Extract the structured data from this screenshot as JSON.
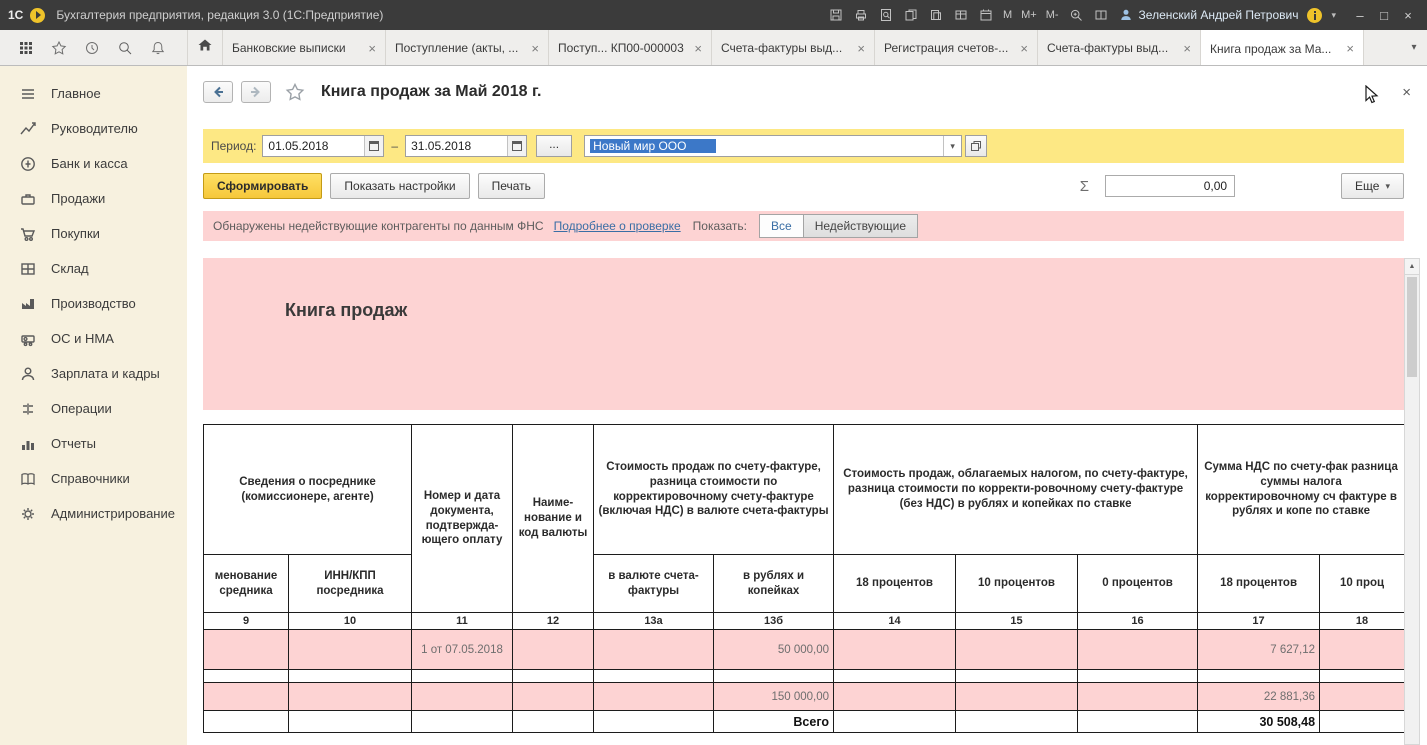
{
  "titlebar": {
    "logo": "1С",
    "title": "Бухгалтерия предприятия, редакция 3.0 (1С:Предприятие)",
    "memory_buttons": [
      "M",
      "M+",
      "M-"
    ],
    "user": "Зеленский Андрей Петрович"
  },
  "window_controls": {
    "minimize": "–",
    "maximize": "□",
    "close": "×"
  },
  "tabbar": {
    "tabs": [
      "Банковские выписки",
      "Поступление (акты, ...",
      "Поступ... КП00-000003",
      "Счета-фактуры выд...",
      "Регистрация счетов-...",
      "Счета-фактуры выд...",
      "Книга продаж за Ма..."
    ]
  },
  "sidebar": {
    "items": [
      "Главное",
      "Руководителю",
      "Банк и касса",
      "Продажи",
      "Покупки",
      "Склад",
      "Производство",
      "ОС и НМА",
      "Зарплата и кадры",
      "Операции",
      "Отчеты",
      "Справочники",
      "Администрирование"
    ]
  },
  "page": {
    "title": "Книга продаж за Май 2018 г."
  },
  "filter": {
    "period_label": "Период:",
    "date_from": "01.05.2018",
    "range_dash": "–",
    "date_to": "31.05.2018",
    "more_dates_button": "...",
    "organization": "Новый мир ООО"
  },
  "actions": {
    "generate": "Сформировать",
    "show_settings": "Показать настройки",
    "print": "Печать",
    "sigma": "Σ",
    "sum_value": "0,00",
    "more": "Еще"
  },
  "warning": {
    "text": "Обнаружены недействующие контрагенты по данным ФНС",
    "link": "Подробнее о проверке",
    "show_label": "Показать:",
    "filter_all": "Все",
    "filter_inactive": "Недействующие"
  },
  "report": {
    "title": "Книга продаж",
    "table": {
      "group_headers": [
        "Сведения о посреднике (комиссионере, агенте)",
        "Номер и дата документа, подтвержда-ющего оплату",
        "Наиме-нование и код валюты",
        "Стоимость продаж по счету-фактуре, разница стоимости по корректировочному счету-фактуре (включая НДС) в валюте счета-фактуры",
        "Стоимость продаж, облагаемых налогом, по счету-фактуре, разница стоимости по корректи-ровочному счету-фактуре (без НДС) в рублях и копейках по ставке",
        "Сумма НДС по счету-фак разница суммы налога корректировочному сч фактуре в рублях и копе по ставке"
      ],
      "subheaders": [
        "менование средника",
        "ИНН/КПП посредника",
        "в валюте счета-фактуры",
        "в рублях и копейках",
        "18 процентов",
        "10 процентов",
        "0 процентов",
        "18 процентов",
        "10 проц"
      ],
      "column_numbers": [
        "9",
        "10",
        "11",
        "12",
        "13а",
        "13б",
        "14",
        "15",
        "16",
        "17",
        "18"
      ],
      "rows": [
        [
          "",
          "",
          "1 от 07.05.2018",
          "",
          "",
          "50 000,00",
          "",
          "",
          "",
          "7 627,12",
          ""
        ],
        [
          "",
          "",
          "",
          "",
          "",
          "150 000,00",
          "",
          "",
          "",
          "22 881,36",
          ""
        ]
      ],
      "total_row": [
        "",
        "",
        "",
        "",
        "",
        "Всего",
        "",
        "",
        "",
        "30 508,48",
        ""
      ]
    }
  },
  "glyphs": {
    "caret_down": "▾",
    "close": "×",
    "scroll_up": "▲"
  }
}
